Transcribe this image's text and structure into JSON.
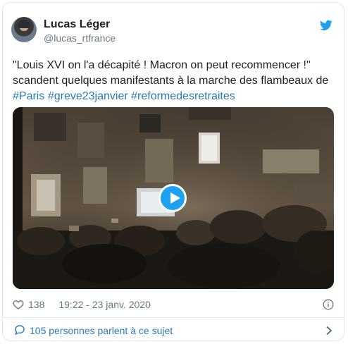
{
  "author": {
    "name": "Lucas Léger",
    "handle": "@lucas_rtfrance"
  },
  "tweet": {
    "line1": "\"Louis XVI on l'a décapité ! Macron on peut recommencer !\"",
    "line2": "scandent quelques manifestants à la marche des flambeaux de",
    "hashtags": [
      "#Paris",
      "#greve23janvier",
      "#reformedesretraites"
    ]
  },
  "stats": {
    "likes": "138",
    "timestamp": "19:22 - 23 janv. 2020"
  },
  "footer": {
    "conversation_label": "105 personnes parlent à ce sujet"
  },
  "icons": {
    "brand": "twitter-bird-icon",
    "play": "play-icon",
    "like": "heart-icon",
    "info": "info-icon",
    "reply": "speech-bubble-icon",
    "chevron": "chevron-right-icon"
  },
  "colors": {
    "brand_blue": "#1da1f2",
    "link_blue": "#2b7bb9",
    "muted_gray": "#697882",
    "text": "#1c2022",
    "border": "#e1e8ed"
  }
}
